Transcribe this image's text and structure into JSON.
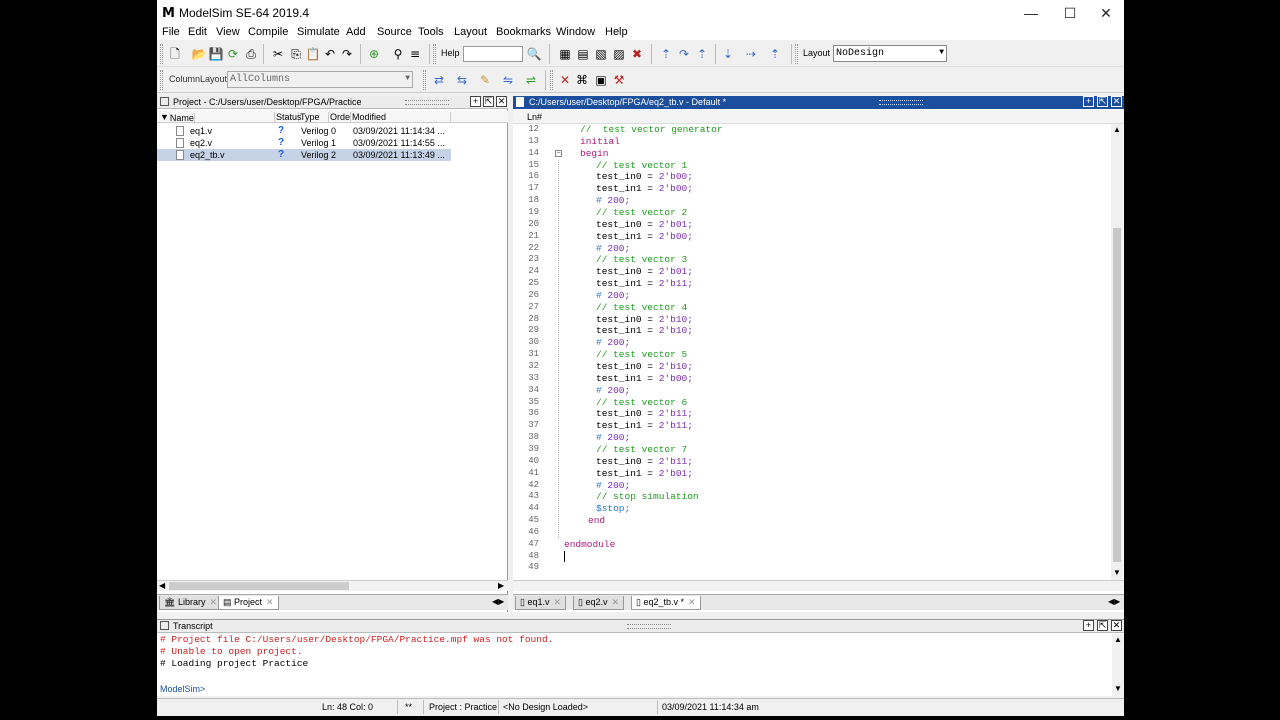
{
  "window": {
    "logo": "M",
    "title": "ModelSim SE-64 2019.4",
    "minimize": "—",
    "maximize": "☐",
    "close": "✕"
  },
  "menu": [
    "File",
    "Edit",
    "View",
    "Compile",
    "Simulate",
    "Add",
    "Source",
    "Tools",
    "Layout",
    "Bookmarks",
    "Window",
    "Help"
  ],
  "toolbar": {
    "help_label": "Help",
    "help_value": "",
    "layout_label": "Layout",
    "layout_value": "NoDesign",
    "column_layout_label": "ColumnLayout",
    "column_layout_value": "AllColumns"
  },
  "project": {
    "title": "Project - C:/Users/user/Desktop/FPGA/Practice",
    "columns": [
      "Name",
      "Status",
      "Type",
      "Orde",
      "Modified"
    ],
    "files": [
      {
        "name": "eq1.v",
        "status": "?",
        "type": "Verilog",
        "order": "0",
        "modified": "03/09/2021 11:14:34 ..."
      },
      {
        "name": "eq2.v",
        "status": "?",
        "type": "Verilog",
        "order": "1",
        "modified": "03/09/2021 11:14:55 ..."
      },
      {
        "name": "eq2_tb.v",
        "status": "?",
        "type": "Verilog",
        "order": "2",
        "modified": "03/09/2021 11:13:49 ..."
      }
    ],
    "selected_index": 2
  },
  "left_tabs": [
    "Library",
    "Project"
  ],
  "editor": {
    "title": "C:/Users/user/Desktop/FPGA/eq2_tb.v - Default *",
    "ln_header": "Ln#",
    "lines": [
      {
        "n": "12",
        "parts": [
          [
            "cm",
            "//  test vector generator"
          ]
        ],
        "indent": 2
      },
      {
        "n": "13",
        "parts": [
          [
            "kw",
            "initial"
          ]
        ],
        "indent": 2
      },
      {
        "n": "14",
        "parts": [
          [
            "kw",
            "begin"
          ]
        ],
        "indent": 2
      },
      {
        "n": "15",
        "parts": [
          [
            "cm",
            "// test vector 1"
          ]
        ],
        "indent": 4
      },
      {
        "n": "16",
        "parts": [
          [
            "id",
            "test_in0 = "
          ],
          [
            "nm",
            "2'b00;"
          ]
        ],
        "indent": 4
      },
      {
        "n": "17",
        "parts": [
          [
            "id",
            "test_in1 = "
          ],
          [
            "nm",
            "2'b00;"
          ]
        ],
        "indent": 4
      },
      {
        "n": "18",
        "parts": [
          [
            "st",
            "# "
          ],
          [
            "nm",
            "200;"
          ]
        ],
        "indent": 4
      },
      {
        "n": "19",
        "parts": [
          [
            "cm",
            "// test vector 2"
          ]
        ],
        "indent": 4
      },
      {
        "n": "20",
        "parts": [
          [
            "id",
            "test_in0 = "
          ],
          [
            "nm",
            "2'b01;"
          ]
        ],
        "indent": 4
      },
      {
        "n": "21",
        "parts": [
          [
            "id",
            "test_in1 = "
          ],
          [
            "nm",
            "2'b00;"
          ]
        ],
        "indent": 4
      },
      {
        "n": "22",
        "parts": [
          [
            "st",
            "# "
          ],
          [
            "nm",
            "200;"
          ]
        ],
        "indent": 4
      },
      {
        "n": "23",
        "parts": [
          [
            "cm",
            "// test vector 3"
          ]
        ],
        "indent": 4
      },
      {
        "n": "24",
        "parts": [
          [
            "id",
            "test_in0 = "
          ],
          [
            "nm",
            "2'b01;"
          ]
        ],
        "indent": 4
      },
      {
        "n": "25",
        "parts": [
          [
            "id",
            "test_in1 = "
          ],
          [
            "nm",
            "2'b11;"
          ]
        ],
        "indent": 4
      },
      {
        "n": "26",
        "parts": [
          [
            "st",
            "# "
          ],
          [
            "nm",
            "200;"
          ]
        ],
        "indent": 4
      },
      {
        "n": "27",
        "parts": [
          [
            "cm",
            "// test vector 4"
          ]
        ],
        "indent": 4
      },
      {
        "n": "28",
        "parts": [
          [
            "id",
            "test_in0 = "
          ],
          [
            "nm",
            "2'b10;"
          ]
        ],
        "indent": 4
      },
      {
        "n": "29",
        "parts": [
          [
            "id",
            "test_in1 = "
          ],
          [
            "nm",
            "2'b10;"
          ]
        ],
        "indent": 4
      },
      {
        "n": "30",
        "parts": [
          [
            "st",
            "# "
          ],
          [
            "nm",
            "200;"
          ]
        ],
        "indent": 4
      },
      {
        "n": "31",
        "parts": [
          [
            "cm",
            "// test vector 5"
          ]
        ],
        "indent": 4
      },
      {
        "n": "32",
        "parts": [
          [
            "id",
            "test_in0 = "
          ],
          [
            "nm",
            "2'b10;"
          ]
        ],
        "indent": 4
      },
      {
        "n": "33",
        "parts": [
          [
            "id",
            "test_in1 = "
          ],
          [
            "nm",
            "2'b00;"
          ]
        ],
        "indent": 4
      },
      {
        "n": "34",
        "parts": [
          [
            "st",
            "# "
          ],
          [
            "nm",
            "200;"
          ]
        ],
        "indent": 4
      },
      {
        "n": "35",
        "parts": [
          [
            "cm",
            "// test vector 6"
          ]
        ],
        "indent": 4
      },
      {
        "n": "36",
        "parts": [
          [
            "id",
            "test_in0 = "
          ],
          [
            "nm",
            "2'b11;"
          ]
        ],
        "indent": 4
      },
      {
        "n": "37",
        "parts": [
          [
            "id",
            "test_in1 = "
          ],
          [
            "nm",
            "2'b11;"
          ]
        ],
        "indent": 4
      },
      {
        "n": "38",
        "parts": [
          [
            "st",
            "# "
          ],
          [
            "nm",
            "200;"
          ]
        ],
        "indent": 4
      },
      {
        "n": "39",
        "parts": [
          [
            "cm",
            "// test vector 7"
          ]
        ],
        "indent": 4
      },
      {
        "n": "40",
        "parts": [
          [
            "id",
            "test_in0 = "
          ],
          [
            "nm",
            "2'b11;"
          ]
        ],
        "indent": 4
      },
      {
        "n": "41",
        "parts": [
          [
            "id",
            "test_in1 = "
          ],
          [
            "nm",
            "2'b01;"
          ]
        ],
        "indent": 4
      },
      {
        "n": "42",
        "parts": [
          [
            "st",
            "# "
          ],
          [
            "nm",
            "200;"
          ]
        ],
        "indent": 4
      },
      {
        "n": "43",
        "parts": [
          [
            "cm",
            "// stop simulation"
          ]
        ],
        "indent": 4
      },
      {
        "n": "44",
        "parts": [
          [
            "st",
            "$stop;"
          ]
        ],
        "indent": 4
      },
      {
        "n": "45",
        "parts": [
          [
            "kw",
            "end"
          ]
        ],
        "indent": 3
      },
      {
        "n": "46",
        "parts": [],
        "indent": 0
      },
      {
        "n": "47",
        "parts": [
          [
            "kw",
            "endmodule"
          ]
        ],
        "indent": 0
      },
      {
        "n": "48",
        "parts": [],
        "indent": 0
      },
      {
        "n": "49",
        "parts": [],
        "indent": 0
      }
    ]
  },
  "editor_tabs": [
    "eq1.v",
    "eq2.v",
    "eq2_tb.v *"
  ],
  "transcript": {
    "title": "Transcript",
    "lines": [
      {
        "text": "# Project file C:/Users/user/Desktop/FPGA/Practice.mpf was not found.",
        "error": true
      },
      {
        "text": "# Unable to open project.",
        "error": true
      },
      {
        "text": "# Loading project Practice",
        "error": false
      }
    ],
    "prompt": "ModelSim>"
  },
  "status": {
    "position": "Ln:  48 Col: 0",
    "marker": "**",
    "project": "Project : Practice",
    "design": "<No Design Loaded>",
    "time": "03/09/2021 11:14:34 am"
  },
  "colors": {
    "editor_title_bg": "#1b4f9e",
    "comment": "#1f9b1f",
    "keyword": "#b01a7a",
    "number": "#7a2fb0",
    "system": "#2876c8",
    "error_text": "#cc2020"
  }
}
